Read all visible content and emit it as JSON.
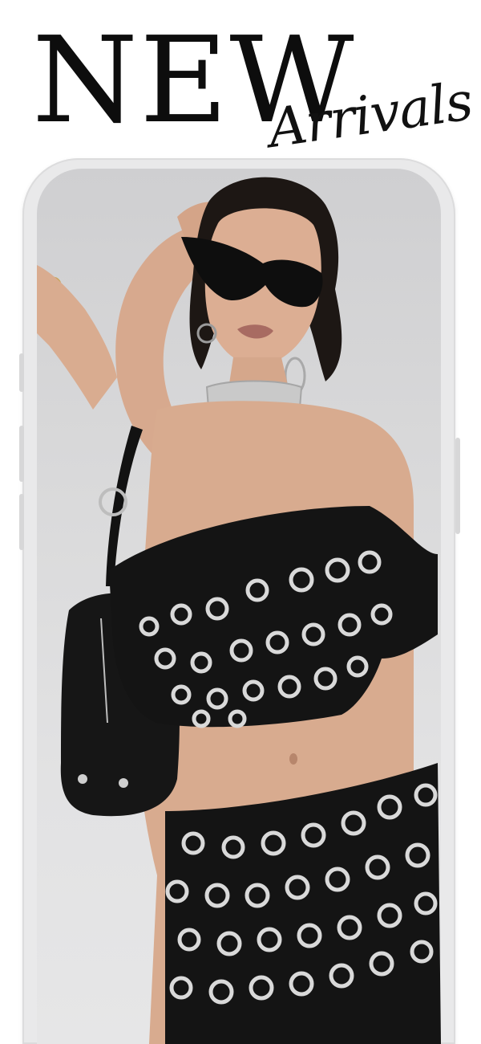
{
  "headline": {
    "main": "NEW",
    "script": "Arrivals"
  },
  "colors": {
    "text": "#0d0d0d",
    "frame": "#e9e9ea",
    "background": "#ffffff",
    "outfit": "#141414",
    "grommet": "#d8d8d8"
  },
  "mockup": {
    "device_icon": "smartphone-frame",
    "photo_subject": "model-in-black-grommet-two-piece"
  }
}
